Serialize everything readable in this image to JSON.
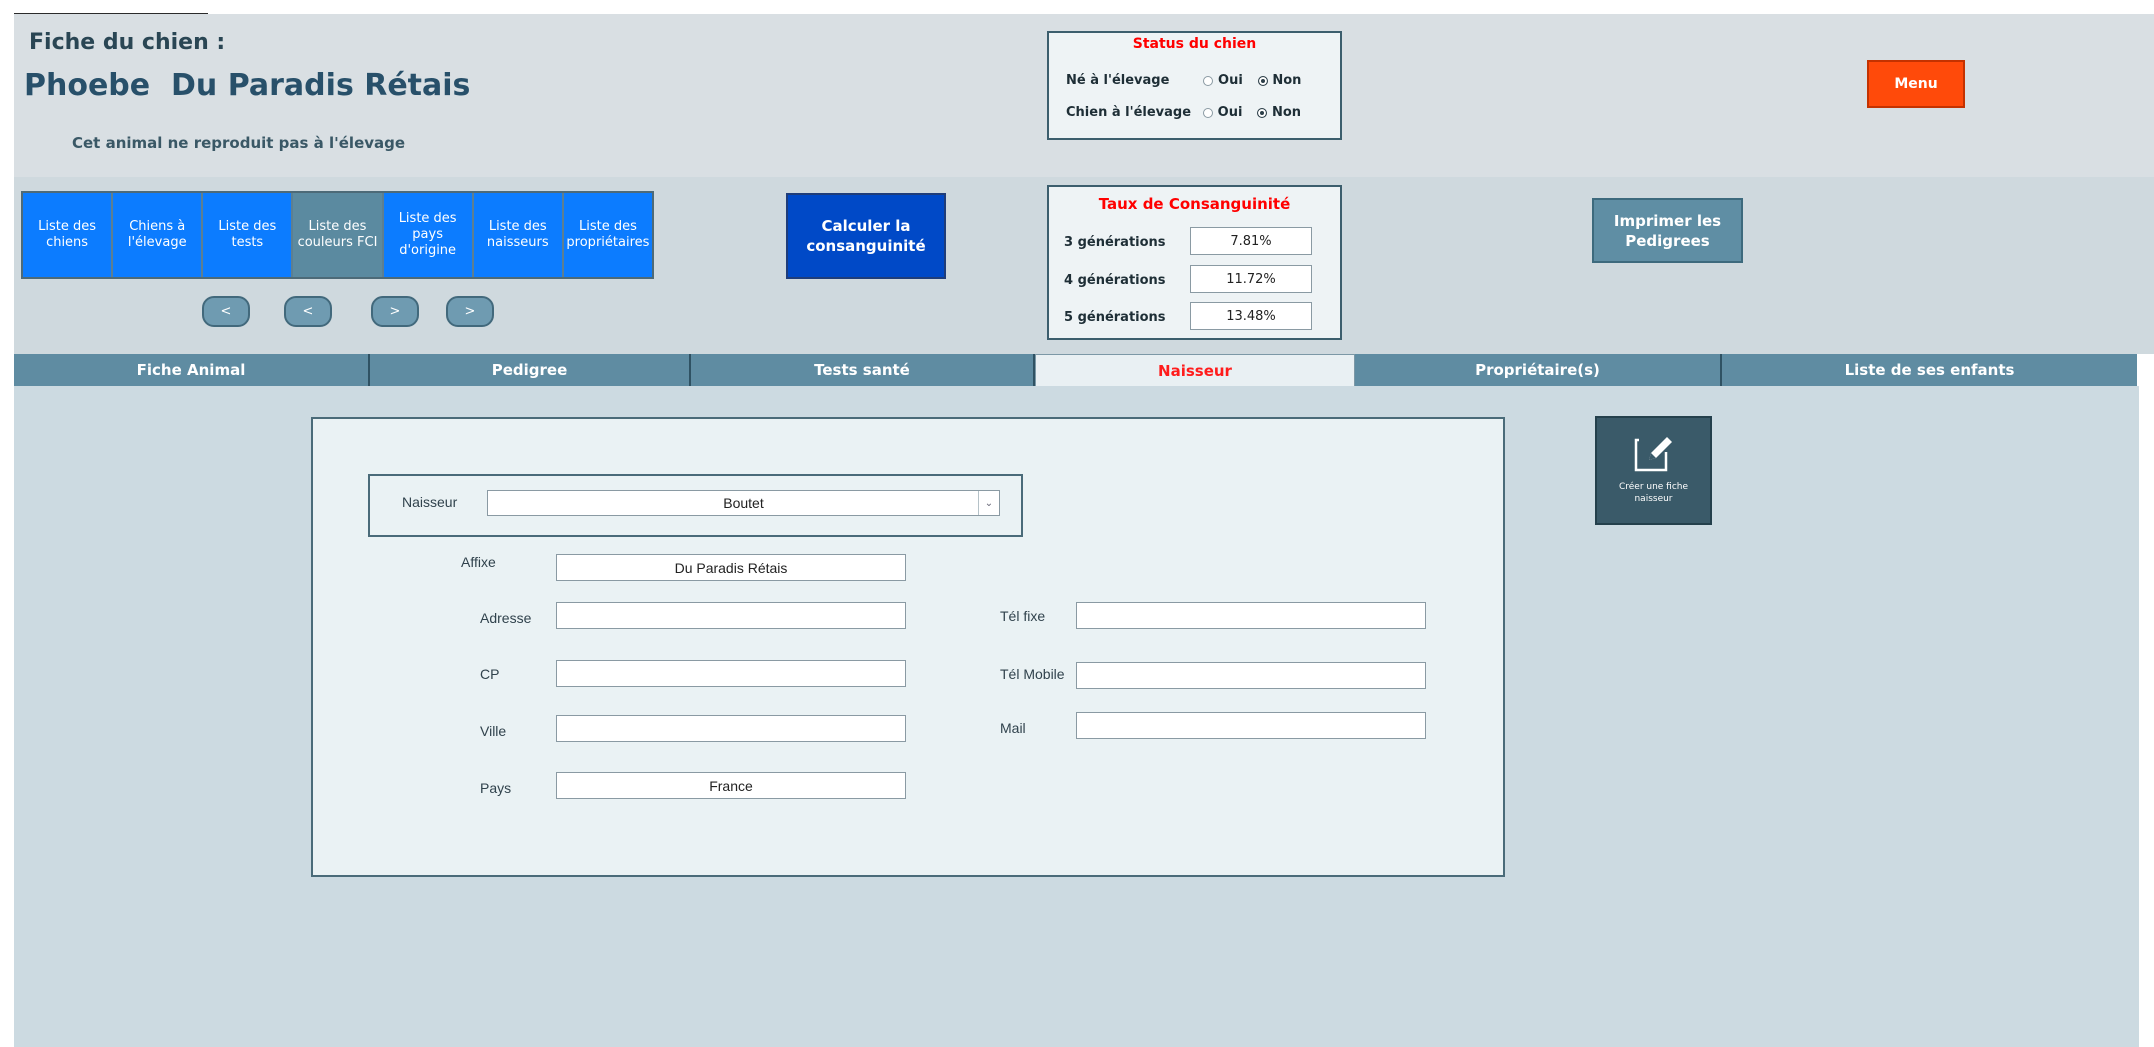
{
  "header": {
    "fiche_label": "Fiche du chien :",
    "dog_name": "Phoebe  Du Paradis Rétais",
    "repro_note": "Cet animal ne reproduit pas à l'élevage"
  },
  "status": {
    "title": "Status du chien",
    "rows": [
      {
        "label": "Né à l'élevage",
        "oui": "Oui",
        "non": "Non",
        "selected": "Non"
      },
      {
        "label": "Chien à l'élevage",
        "oui": "Oui",
        "non": "Non",
        "selected": "Non"
      }
    ]
  },
  "menu_label": "Menu",
  "nav": [
    "Liste des chiens",
    "Chiens à l'élevage",
    "Liste des tests",
    "Liste des couleurs FCI",
    "Liste des pays d'origine",
    "Liste des naisseurs",
    "Liste des propriétaires"
  ],
  "arrows": [
    "<",
    "<",
    ">",
    ">"
  ],
  "calc_label": "Calculer la consanguinité",
  "consanguinity": {
    "title": "Taux de Consanguinité",
    "rows": [
      {
        "label": "3 générations",
        "value": "7.81%"
      },
      {
        "label": "4 générations",
        "value": "11.72%"
      },
      {
        "label": "5 générations",
        "value": "13.48%"
      }
    ]
  },
  "print_label": "Imprimer les Pedigrees",
  "tabs": [
    "Fiche Animal",
    "Pedigree",
    "Tests santé",
    "Naisseur",
    "Propriétaire(s)",
    "Liste de ses enfants"
  ],
  "active_tab": "Naisseur",
  "form": {
    "naisseur_label": "Naisseur",
    "naisseur_value": "Boutet",
    "affixe_label": "Affixe",
    "affixe_value": "Du Paradis Rétais",
    "adresse_label": "Adresse",
    "adresse_value": "",
    "cp_label": "CP",
    "cp_value": "",
    "ville_label": "Ville",
    "ville_value": "",
    "pays_label": "Pays",
    "pays_value": "France",
    "tel_fixe_label": "Tél fixe",
    "tel_fixe_value": "",
    "tel_mobile_label": "Tél Mobile",
    "tel_mobile_value": "",
    "mail_label": "Mail",
    "mail_value": ""
  },
  "create_label": "Créer une fiche naisseur",
  "colors": {
    "menu": "#ff4a0a",
    "nav": "#0c7cff",
    "calc": "#0049c7",
    "tab": "#5f8ca2",
    "active_tab_text": "#ff1c1c"
  }
}
